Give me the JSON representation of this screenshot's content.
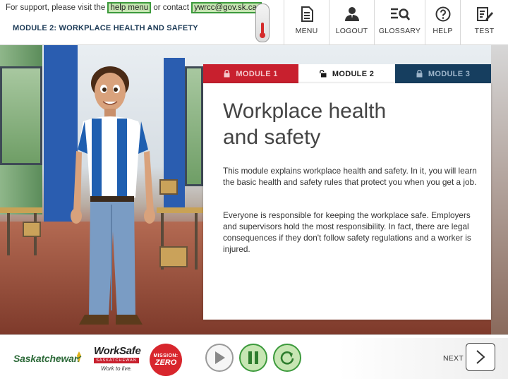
{
  "header": {
    "support_prefix": "For support, please visit the",
    "help_link": "help menu",
    "support_middle": "or contact",
    "email": "ywrcc@gov.sk.ca.",
    "module_title": "MODULE 2: WORKPLACE HEALTH AND SAFETY"
  },
  "nav": {
    "menu": "MENU",
    "logout": "LOGOUT",
    "glossary": "GLOSSARY",
    "help": "HELP",
    "test": "TEST"
  },
  "tabs": [
    {
      "label": "MODULE 1",
      "state": "locked",
      "color": "#c8202e"
    },
    {
      "label": "MODULE 2",
      "state": "unlocked-active",
      "color": "#ffffff"
    },
    {
      "label": "MODULE 3",
      "state": "locked",
      "color": "#163e5f"
    }
  ],
  "content": {
    "title_line1": "Workplace health",
    "title_line2": "and safety",
    "para1": "This module explains workplace health and safety. In it, you will learn the basic health and safety rules that protect you when you get a job.",
    "para2": "Everyone is responsible for keeping the workplace safe. Employers and supervisors hold the most responsibility. In fact, there are legal consequences if they don't follow safety regulations and a worker is injured."
  },
  "footer": {
    "saskatchewan": "Saskatchewan",
    "worksafe_name": "WorkSafe",
    "worksafe_region": "SASKATCHEWAN",
    "worksafe_tagline": "Work to live.",
    "mission_line1": "MISSION:",
    "mission_line2": "ZERO",
    "next_label": "NEXT"
  },
  "icons": {
    "menu": "document-icon",
    "logout": "user-icon",
    "glossary": "list-search-icon",
    "help": "question-icon",
    "test": "edit-doc-icon",
    "play": "play-icon",
    "pause": "pause-icon",
    "replay": "replay-icon",
    "next": "chevron-right-icon"
  },
  "colors": {
    "accent_green": "#3c9a3c",
    "highlight_green": "#c7e6b3",
    "tab_red": "#c8202e",
    "tab_navy": "#163e5f",
    "title_navy": "#1d3b57"
  }
}
